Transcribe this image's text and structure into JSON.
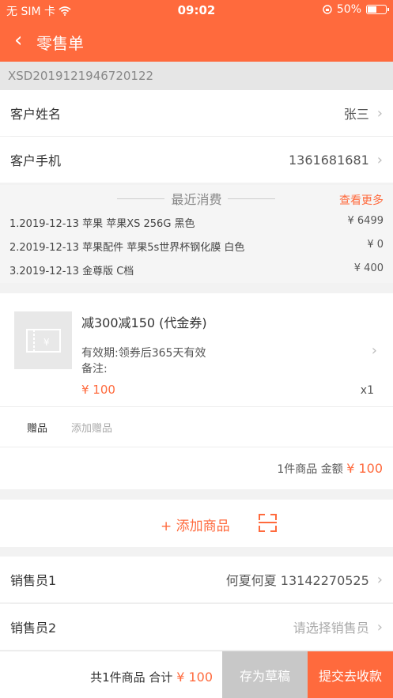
{
  "status_bar": {
    "carrier": "无 SIM 卡",
    "time": "09:02",
    "battery": "50%",
    "battery_level": 0.5
  },
  "nav": {
    "title": "零售单"
  },
  "order_no": "XSD2019121946720122",
  "customer": {
    "name_label": "客户姓名",
    "name_value": "张三",
    "phone_label": "客户手机",
    "phone_value": "1361681681"
  },
  "recent": {
    "title": "最近消费",
    "more": "查看更多",
    "items": [
      {
        "desc": "1.2019-12-13 苹果 苹果XS 256G 黑色",
        "price": "¥ 6499"
      },
      {
        "desc": "2.2019-12-13 苹果配件 苹果5s世界杯钢化膜 白色",
        "price": "¥ 0"
      },
      {
        "desc": "3.2019-12-13 金尊版 C档",
        "price": "¥ 400"
      }
    ]
  },
  "product": {
    "name": "减300减150 (代金券)",
    "validity": "有效期:领券后365天有效",
    "note": "备注:",
    "price": "¥ 100",
    "qty": "x1",
    "gift_label": "赠品",
    "gift_add": "添加赠品",
    "summary_count": "1件商品  金额",
    "summary_amount": "¥ 100"
  },
  "add_product": "+ 添加商品",
  "sales": {
    "s1_label": "销售员1",
    "s1_value": "何夏何夏 13142270525",
    "s2_label": "销售员2",
    "s2_placeholder": "请选择销售员"
  },
  "bottom": {
    "total_text": "共1件商品 合计",
    "total_amount": "¥ 100",
    "draft": "存为草稿",
    "submit": "提交去收款"
  },
  "colors": {
    "accent": "#ff6a3d",
    "draft_bg": "#c8c8c8"
  }
}
